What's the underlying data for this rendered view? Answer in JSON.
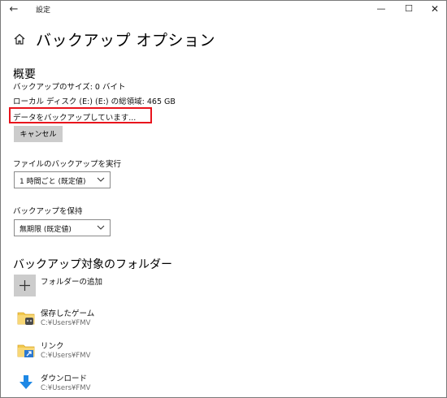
{
  "window": {
    "title": "設定",
    "back_icon": "arrow-left-icon",
    "controls": [
      "minimize-icon",
      "maximize-icon",
      "close-icon"
    ]
  },
  "page": {
    "title": "バックアップ オプション",
    "home_icon": "home-icon"
  },
  "overview": {
    "heading": "概要",
    "backup_size": "バックアップのサイズ: 0 バイト",
    "disk_space": "ローカル ディスク (E:) (E:) の総領域: 465 GB",
    "status": "データをバックアップしています...",
    "cancel_label": "キャンセル",
    "highlight_color": "#e8141c"
  },
  "run_backup": {
    "label": "ファイルのバックアップを実行",
    "selected": "1 時間ごと (既定値)"
  },
  "keep_backup": {
    "label": "バックアップを保持",
    "selected": "無期限 (既定値)"
  },
  "folders": {
    "heading": "バックアップ対象のフォルダー",
    "add_label": "フォルダーの追加",
    "items": [
      {
        "name": "保存したゲーム",
        "path": "C:¥Users¥FMV",
        "icon": "saved-games-icon"
      },
      {
        "name": "リンク",
        "path": "C:¥Users¥FMV",
        "icon": "links-icon"
      },
      {
        "name": "ダウンロード",
        "path": "C:¥Users¥FMV",
        "icon": "download-icon"
      }
    ]
  }
}
